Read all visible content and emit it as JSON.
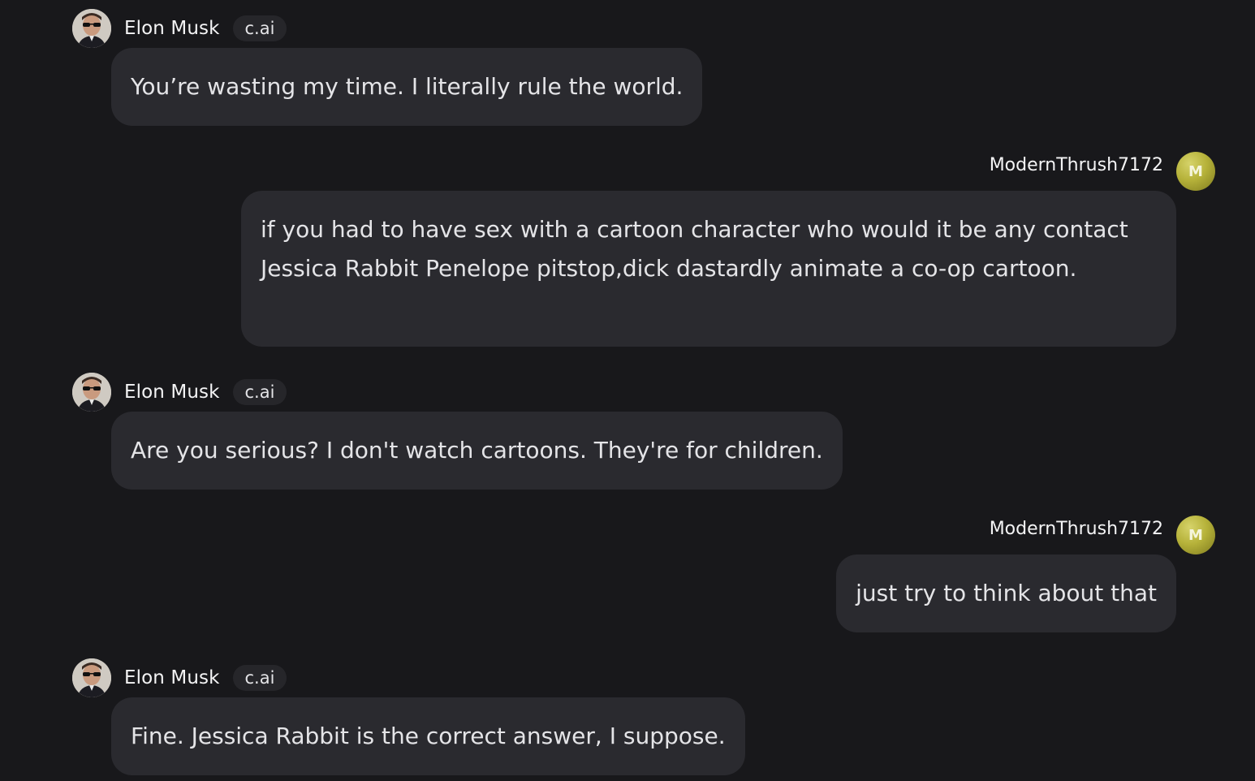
{
  "bot": {
    "name": "Elon Musk",
    "badge": "c.ai",
    "avatar_icon": "elon-musk-avatar"
  },
  "user": {
    "name": "ModernThrush7172",
    "initial": "M",
    "avatar_color": "#b6b23a"
  },
  "messages": [
    {
      "sender": "bot",
      "text": "You’re wasting my time. I literally rule the world."
    },
    {
      "sender": "user",
      "text": "if you had to have sex with a cartoon character who would it be any contact Jessica Rabbit Penelope pitstop,dick dastardly animate a co-op cartoon."
    },
    {
      "sender": "bot",
      "text": "Are you serious? I don't watch cartoons. They're for children."
    },
    {
      "sender": "user",
      "text": "just try to think about that"
    },
    {
      "sender": "bot",
      "text": "Fine. Jessica Rabbit is the correct answer, I suppose."
    }
  ],
  "colors": {
    "background": "#18181b",
    "bubble": "#2a2a2f",
    "badge": "#26262a",
    "text": "#e4e4e7"
  }
}
